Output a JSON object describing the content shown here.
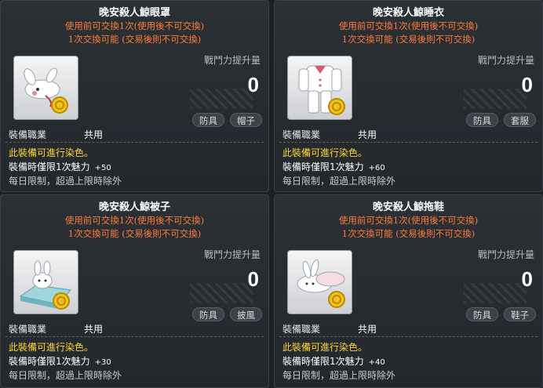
{
  "common": {
    "trade_line1": "使用前可交換1次(使用後不可交換)",
    "trade_line2": "1次交換可能 (交易後則不可交換)",
    "power_label": "戰鬥力提升量",
    "power_value": "0",
    "job_label": "裝備職業",
    "job_value": "共用",
    "dye_text": "此裝備可進行染色。",
    "equip_prefix": "裝備時僅限1次魅力",
    "daily_text": "每日限制，超過上限時除外",
    "colors": {
      "trade": "#ff7a3a",
      "dye": "#ffd53a"
    }
  },
  "items": [
    {
      "title": "晚安殺人鯨眼罩",
      "tag1": "防具",
      "tag2": "帽子",
      "charm": "+50",
      "icon": "eye-mask-icon"
    },
    {
      "title": "晚安殺人鯨睡衣",
      "tag1": "防具",
      "tag2": "套服",
      "charm": "+60",
      "icon": "pajamas-icon"
    },
    {
      "title": "晚安殺人鯨被子",
      "tag1": "防具",
      "tag2": "披風",
      "charm": "+30",
      "icon": "blanket-icon"
    },
    {
      "title": "晚安殺人鯨拖鞋",
      "tag1": "防具",
      "tag2": "鞋子",
      "charm": "+40",
      "icon": "slippers-icon"
    }
  ]
}
